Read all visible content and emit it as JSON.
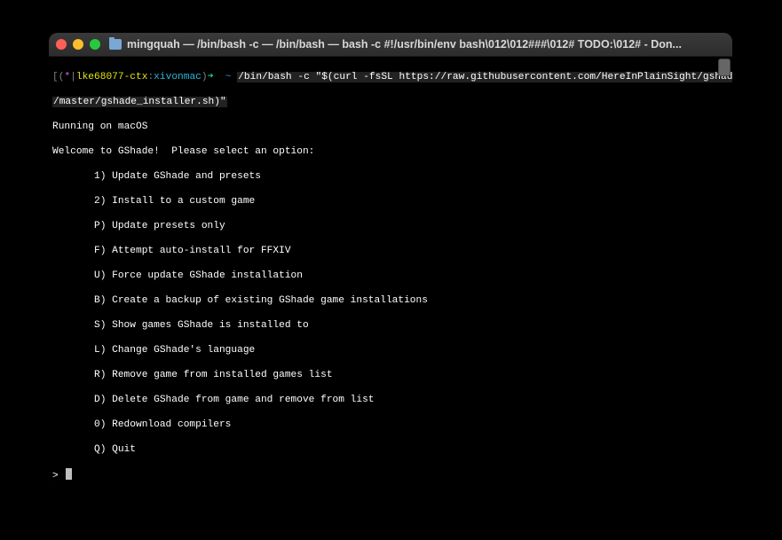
{
  "window": {
    "title": "mingquah — /bin/bash -c  — /bin/bash — bash -c #!/usr/bin/env bash\\012\\012###\\012# TODO:\\012# - Don..."
  },
  "prompt": {
    "open": "[(",
    "star": "*",
    "bar": "|",
    "ctx": "lke68077-ctx",
    "sep": ":",
    "host": "xivonmac",
    "close": ")",
    "arrow": "➜ ",
    "path": " ~ ",
    "cmd1": "/bin/bash -c \"$(curl -fsSL https://raw.githubusercontent.com/HereInPlainSight/gshade_installer",
    "cmd2": "/master/gshade_installer.sh)\"",
    "close_br": "]"
  },
  "output": {
    "running": "Running on macOS",
    "welcome": "Welcome to GShade!  Please select an option:"
  },
  "menu": [
    "1) Update GShade and presets",
    "2) Install to a custom game",
    "P) Update presets only",
    "F) Attempt auto-install for FFXIV",
    "U) Force update GShade installation",
    "B) Create a backup of existing GShade game installations",
    "S) Show games GShade is installed to",
    "L) Change GShade's language",
    "R) Remove game from installed games list",
    "D) Delete GShade from game and remove from list",
    "0) Redownload compilers",
    "Q) Quit"
  ],
  "input_prompt": "> "
}
